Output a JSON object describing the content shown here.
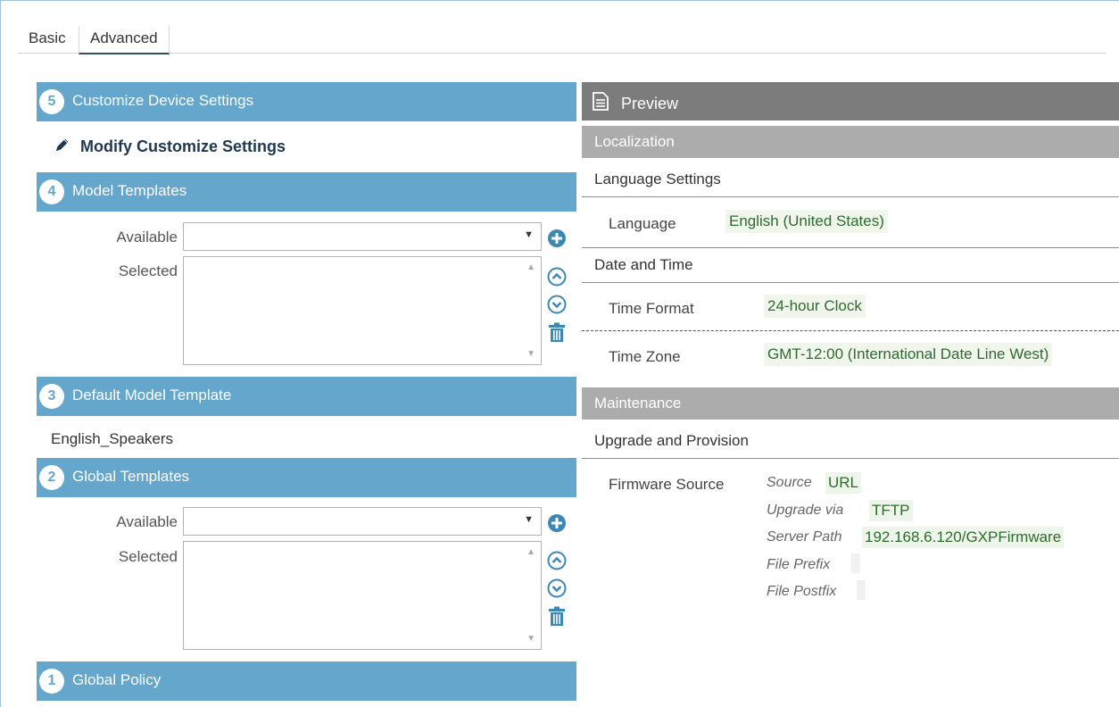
{
  "tabs": {
    "basic": "Basic",
    "advanced": "Advanced"
  },
  "sections": {
    "customize": {
      "number": "5",
      "title": "Customize Device Settings"
    },
    "modify_link": "Modify Customize Settings",
    "model_templates": {
      "number": "4",
      "title": "Model Templates",
      "available_label": "Available",
      "selected_label": "Selected",
      "available_value": ""
    },
    "default_model_template": {
      "number": "3",
      "title": "Default Model Template",
      "value": "English_Speakers"
    },
    "global_templates": {
      "number": "2",
      "title": "Global Templates",
      "available_label": "Available",
      "selected_label": "Selected",
      "available_value": ""
    },
    "global_policy": {
      "number": "1",
      "title": "Global Policy"
    }
  },
  "preview": {
    "title": "Preview",
    "localization": {
      "title": "Localization",
      "language_settings": {
        "title": "Language Settings",
        "language_key": "Language",
        "language_value": "English (United States)"
      },
      "date_time": {
        "title": "Date and Time",
        "time_format_key": "Time Format",
        "time_format_value": "24-hour Clock",
        "time_zone_key": "Time Zone",
        "time_zone_value": "GMT-12:00 (International Date Line West)"
      }
    },
    "maintenance": {
      "title": "Maintenance",
      "upgrade": {
        "title": "Upgrade and Provision",
        "firmware_source_key": "Firmware Source",
        "source_key": "Source",
        "source_value": "URL",
        "upgrade_via_key": "Upgrade via",
        "upgrade_via_value": "TFTP",
        "server_path_key": "Server Path",
        "server_path_value": "192.168.6.120/GXPFirmware",
        "file_prefix_key": "File Prefix",
        "file_postfix_key": "File Postfix"
      }
    }
  },
  "colors": {
    "section_blue": "#64a6cc",
    "preview_dark": "#7c7c7c",
    "band_grey": "#acacac",
    "value_green": "#2e6b2e",
    "icon_blue": "#3c88b5"
  },
  "icons": {
    "edit": "pencil-icon",
    "add": "plus-circle-icon",
    "up": "arrow-up-circle-icon",
    "down": "arrow-down-circle-icon",
    "delete": "trash-icon",
    "doc": "document-icon"
  }
}
